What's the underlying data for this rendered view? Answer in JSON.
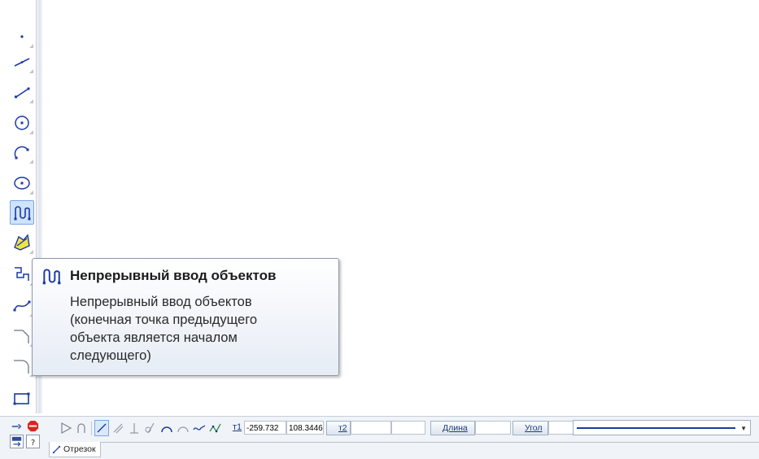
{
  "tooltip": {
    "title": "Непрерывный ввод объектов",
    "body_lines": [
      "Непрерывный ввод объектов",
      "(конечная точка предыдущего",
      "объекта является началом",
      "следующего)"
    ]
  },
  "toolbar": {
    "tools": [
      {
        "name": "point-tool",
        "icon": "point-icon"
      },
      {
        "name": "auxiliary-line-tool",
        "icon": "auxiliary-line-icon"
      },
      {
        "name": "segment-tool",
        "icon": "segment-icon"
      },
      {
        "name": "circle-tool",
        "icon": "circle-icon"
      },
      {
        "name": "arc-tool",
        "icon": "arc-icon"
      },
      {
        "name": "ellipse-tool",
        "icon": "ellipse-icon"
      },
      {
        "name": "continuous-input-tool",
        "icon": "continuous-input-icon",
        "active": true
      },
      {
        "name": "polyline-tool",
        "icon": "polyline-icon"
      },
      {
        "name": "polygon-tool",
        "icon": "polygon-icon"
      },
      {
        "name": "bezier-tool",
        "icon": "bezier-icon"
      },
      {
        "name": "chamfer-tool",
        "icon": "chamfer-icon"
      },
      {
        "name": "fillet-tool",
        "icon": "fillet-icon"
      },
      {
        "name": "rectangle-tool",
        "icon": "rectangle-icon"
      }
    ]
  },
  "params": {
    "t1_label": "т1",
    "t1_x": "-259.732",
    "t1_y": "108.3446",
    "t2_label": "т2",
    "t2_x": "",
    "t2_y": "",
    "length_label": "Длина",
    "length_value": "",
    "angle_label": "Угол",
    "angle_value": ""
  },
  "tabs": {
    "active_label": "Отрезок"
  },
  "colors": {
    "accent": "#1b3aa3",
    "tooltip_border": "#8a98ac",
    "active_tool_bg": "#cfe3fb"
  }
}
